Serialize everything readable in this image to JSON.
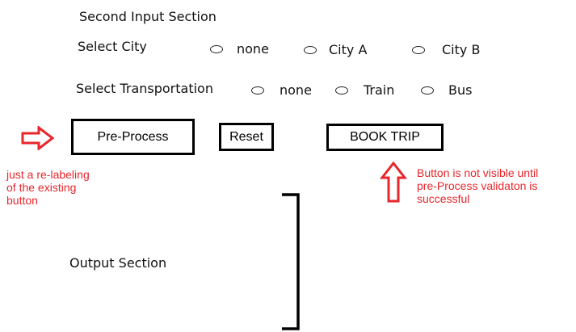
{
  "colors": {
    "annotation": "#e8262c",
    "text": "#111111",
    "border": "#000000"
  },
  "second_input": {
    "title": "Second Input Section",
    "city": {
      "label": "Select City",
      "options": [
        "none",
        "City A",
        "City B"
      ]
    },
    "transport": {
      "label": "Select Transportation",
      "options": [
        "none",
        "Train",
        "Bus"
      ]
    }
  },
  "buttons": {
    "preprocess": "Pre-Process",
    "reset": "Reset",
    "book": "BOOK TRIP"
  },
  "annotations": {
    "relabel": "just a re-labeling\nof the existing\nbutton",
    "visibility": "Button is not visible until\npre-Process validaton is\nsuccessful"
  },
  "icons": {
    "preprocess_arrow": "arrow-right-icon",
    "book_arrow": "arrow-up-icon"
  },
  "output": {
    "label": "Output Section"
  }
}
